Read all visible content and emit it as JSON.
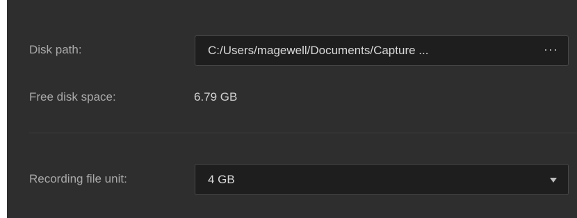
{
  "disk_path": {
    "label": "Disk path:",
    "value": "C:/Users/magewell/Documents/Capture ...",
    "browse_label": "···"
  },
  "free_disk_space": {
    "label": "Free disk space:",
    "value": "6.79 GB"
  },
  "recording_file_unit": {
    "label": "Recording file unit:",
    "selected": "4 GB",
    "arrow_icon": "dropdown-arrow-icon"
  },
  "colors": {
    "panel_background": "#2e2e2e",
    "field_background": "#1e1e1e",
    "label_text": "#aaaaaa",
    "value_text": "#d8d8d8"
  }
}
